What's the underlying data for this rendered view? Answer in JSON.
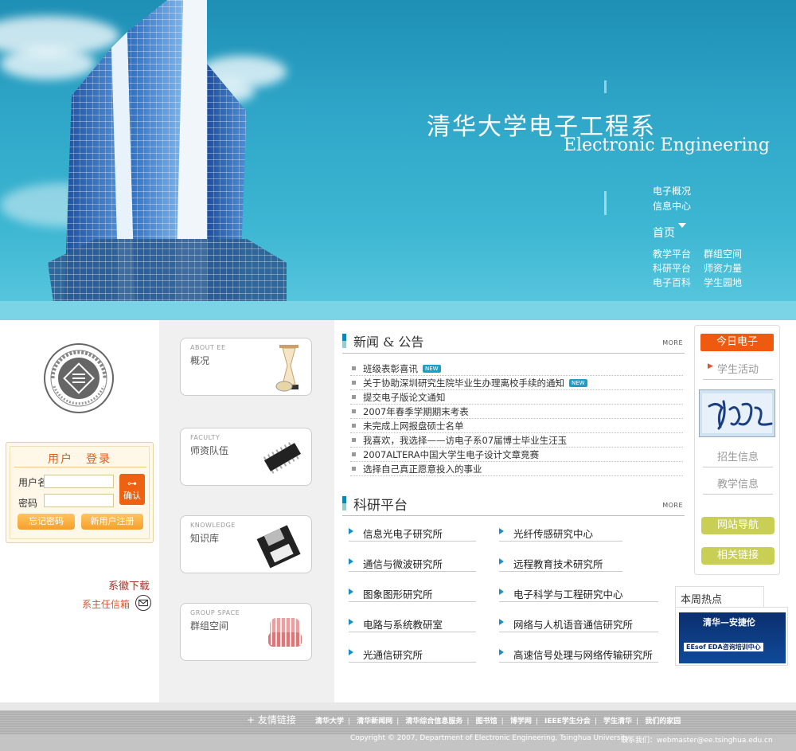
{
  "banner": {
    "title_cn": "清华大学电子工程系",
    "title_en": "Electronic Engineering",
    "nav_top": [
      "电子概况",
      "信息中心"
    ],
    "nav_home": "首页",
    "nav_left": [
      "教学平台",
      "科研平台",
      "电子百科"
    ],
    "nav_right": [
      "群组空间",
      "师资力量",
      "学生园地"
    ]
  },
  "login": {
    "title": "用户　登录",
    "username_label": "用户名",
    "password_label": "密码",
    "confirm_label": "确认",
    "forgot_label": "忘记密码",
    "register_label": "新用户注册"
  },
  "left_links": {
    "logo_download": "系徽下载",
    "director_mail": "系主任信箱"
  },
  "cards": [
    {
      "en": "ABOUT EE",
      "cn": "概况"
    },
    {
      "en": "FACULTY",
      "cn": "师资队伍"
    },
    {
      "en": "KNOWLEDGE",
      "cn": "知识库"
    },
    {
      "en": "GROUP SPACE",
      "cn": "群组空间"
    }
  ],
  "news": {
    "title": "新闻 & 公告",
    "more": "MORE",
    "items": [
      {
        "text": "班级表彰喜讯",
        "badge": "NEW"
      },
      {
        "text": "关于协助深圳研究生院毕业生办理离校手续的通知",
        "badge": "NEW"
      },
      {
        "text": "提交电子版论文通知",
        "badge": ""
      },
      {
        "text": "2007年春季学期期末考表",
        "badge": ""
      },
      {
        "text": "未完成上网报盘硕士名单",
        "badge": ""
      },
      {
        "text": "我喜欢，我选择——访电子系07届博士毕业生汪玉",
        "badge": ""
      },
      {
        "text": "2007ALTERA中国大学生电子设计文章竞赛",
        "badge": ""
      },
      {
        "text": "选择自己真正愿意投入的事业",
        "badge": ""
      }
    ]
  },
  "research": {
    "title": "科研平台",
    "more": "MORE",
    "labs_left": [
      "信息光电子研究所",
      "通信与微波研究所",
      "图象图形研究所",
      "电路与系统教研室",
      "光通信研究所"
    ],
    "labs_right": [
      "光纤传感研究中心",
      "远程教育技术研究所",
      "电子科学与工程研究中心",
      "网络与人机语音通信研究所",
      "高速信号处理与网络传输研究所"
    ]
  },
  "right": {
    "today": "今日电子",
    "student": "学生活动",
    "admission": "招生信息",
    "teaching": "教学信息",
    "site_nav": "网站导航",
    "related": "相关链接",
    "hot_title": "本周热点",
    "hot_banner_1": "清华—安捷伦",
    "hot_banner_2": "EEsof EDA咨询培训中心"
  },
  "footer": {
    "friend_links": "+ 友情链接",
    "links": [
      "清华大学",
      "清华新闻网",
      "清华综合信息服务",
      "图书馆",
      "博学网",
      "IEEE学生分会",
      "学生清华",
      "我们的家园"
    ],
    "copyright": "Copyright © 2007, Department of Electronic Engineering, Tsinghua University",
    "contact": "联系我们：webmaster@ee.tsinghua.edu.cn"
  }
}
